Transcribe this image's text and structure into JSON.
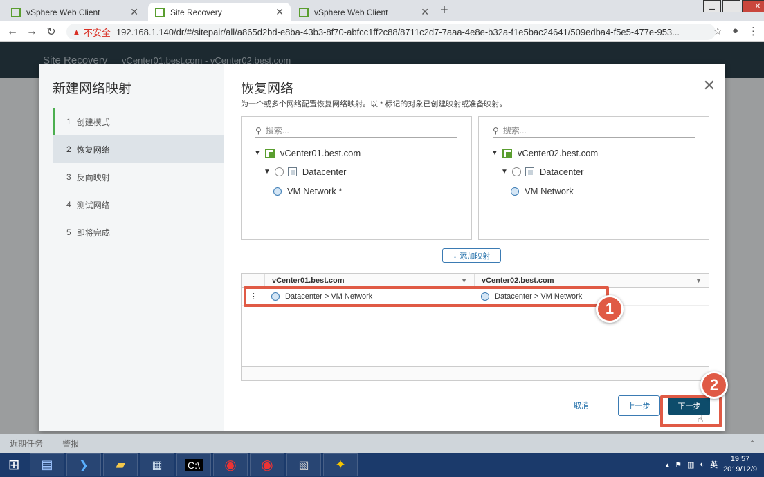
{
  "browser": {
    "tabs": [
      {
        "label": "vSphere Web Client"
      },
      {
        "label": "Site Recovery"
      },
      {
        "label": "vSphere Web Client"
      }
    ],
    "insecure_label": "不安全",
    "url": "192.168.1.140/dr/#/sitepair/all/a865d2bd-e8ba-43b3-8f70-abfcc1ff2c88/8711c2d7-7aaa-4e8e-b32a-f1e5bac24641/509edba4-f5e5-477e-953..."
  },
  "app": {
    "title": "Site Recovery",
    "subtitle": "vCenter01.best.com - vCenter02.best.com"
  },
  "wizard": {
    "title": "新建网络映射",
    "steps": [
      {
        "num": "1",
        "label": "创建模式"
      },
      {
        "num": "2",
        "label": "恢复网络"
      },
      {
        "num": "3",
        "label": "反向映射"
      },
      {
        "num": "4",
        "label": "测试网络"
      },
      {
        "num": "5",
        "label": "即将完成"
      }
    ],
    "content_title": "恢复网络",
    "description": "为一个或多个网络配置恢复网络映射。以 * 标记的对象已创建映射或准备映射。",
    "search_placeholder": "搜索...",
    "left_tree": {
      "vcenter": "vCenter01.best.com",
      "datacenter": "Datacenter",
      "network": "VM Network *"
    },
    "right_tree": {
      "vcenter": "vCenter02.best.com",
      "datacenter": "Datacenter",
      "network": "VM Network"
    },
    "add_mapping_label": "添加映射",
    "grid": {
      "col1": "vCenter01.best.com",
      "col2": "vCenter02.best.com",
      "row_left": "Datacenter > VM Network",
      "row_right": "Datacenter > VM Network"
    },
    "cancel_label": "取消",
    "prev_label": "上一步",
    "next_label": "下一步",
    "badge1": "1",
    "badge2": "2"
  },
  "bottom": {
    "recent_tasks": "近期任务",
    "alarms": "警报"
  },
  "taskbar": {
    "ime": "英",
    "time": "19:57",
    "date": "2019/12/9"
  },
  "colors": {
    "accent": "#0d4c6b",
    "highlight": "#e05a45",
    "step_done": "#4caf50"
  }
}
